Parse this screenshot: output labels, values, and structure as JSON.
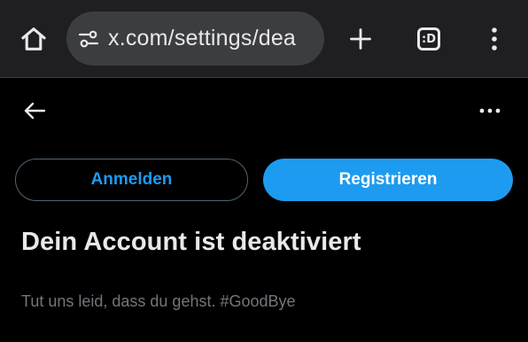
{
  "browser": {
    "url": "x.com/settings/dea",
    "tab_count_icon": ":D",
    "icons": {
      "home": "home-icon",
      "site_settings": "tune-icon",
      "new_tab": "plus-icon",
      "tabs": "tab-switcher-icon",
      "menu": "more-vert-icon"
    }
  },
  "page": {
    "back_icon": "arrow-left-icon",
    "more_icon": "more-horiz-icon",
    "login_label": "Anmelden",
    "register_label": "Registrieren",
    "heading": "Dein Account ist deaktiviert",
    "subtext": "Tut uns leid, dass du gehst. #GoodBye"
  },
  "colors": {
    "accent": "#1d9bf0",
    "background": "#000000",
    "chrome": "#1f1f23",
    "urlbar": "#3c3d41",
    "muted_text": "#71767b"
  }
}
